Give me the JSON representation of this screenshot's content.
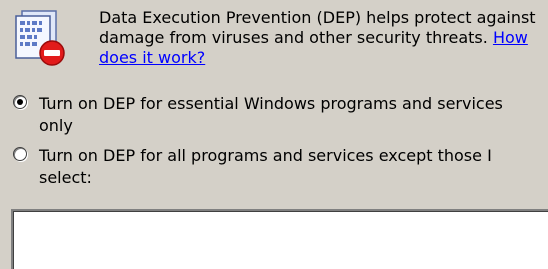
{
  "header": {
    "description_text": "Data Execution Prevention (DEP) helps protect against damage from viruses and other security threats.",
    "help_link": "How does it work?"
  },
  "icons": {
    "dep_icon": "dep-shield-binary-icon",
    "blocked_badge": "no-entry-icon"
  },
  "options": [
    {
      "label": "Turn on DEP for essential Windows programs and services only",
      "selected": true
    },
    {
      "label": "Turn on DEP for all programs and services except those I select:",
      "selected": false
    }
  ],
  "colors": {
    "window_background": "#d4d0c8",
    "link": "#0000ff",
    "badge_red": "#e21b1b"
  }
}
